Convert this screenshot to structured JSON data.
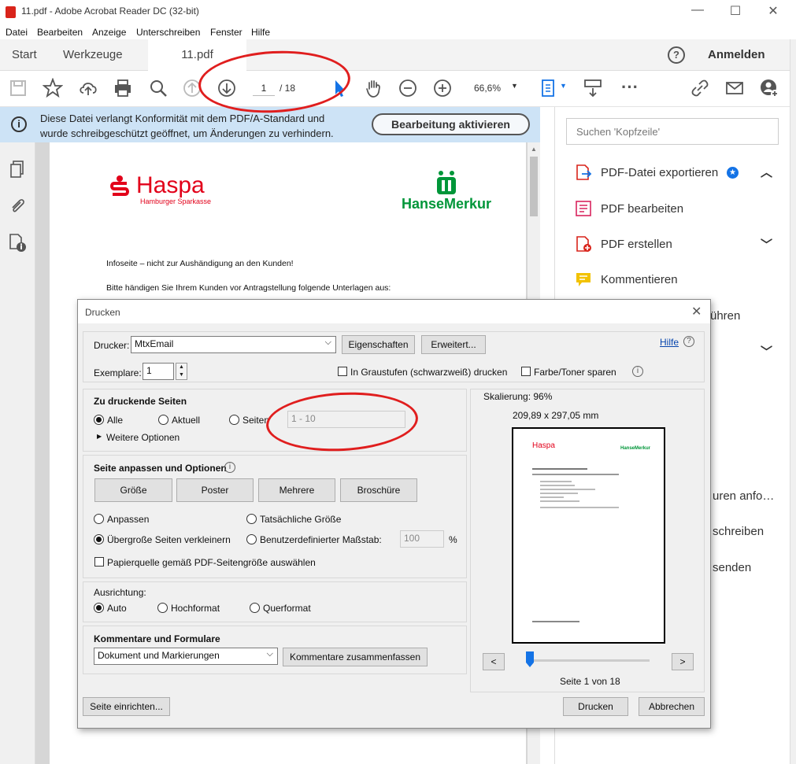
{
  "window": {
    "title": "11.pdf - Adobe Acrobat Reader DC (32-bit)"
  },
  "menu": [
    "Datei",
    "Bearbeiten",
    "Anzeige",
    "Unterschreiben",
    "Fenster",
    "Hilfe"
  ],
  "tabs": {
    "start": "Start",
    "tools": "Werkzeuge",
    "doc": "11.pdf",
    "signin": "Anmelden"
  },
  "toolbar": {
    "page_current": "1",
    "page_total": "/ 18",
    "zoom": "66,6%"
  },
  "notice": {
    "line1": "Diese Datei verlangt Konformität mit dem PDF/A-Standard und",
    "line2": "wurde schreibgeschützt geöffnet, um Änderungen zu verhindern.",
    "button": "Bearbeitung aktivieren"
  },
  "document": {
    "logo_left": "Haspa",
    "logo_left_sub": "Hamburger Sparkasse",
    "logo_right": "HanseMerkur",
    "heading": "Infoseite – nicht zur Aushändigung an den Kunden!",
    "line2": "Bitte händigen Sie Ihrem Kunden vor Antragstellung folgende Unterlagen aus:"
  },
  "right_panel": {
    "search_placeholder": "Suchen 'Kopfzeile'",
    "items": [
      "PDF-Datei exportieren",
      "PDF bearbeiten",
      "PDF erstellen",
      "Kommentieren"
    ],
    "partial": [
      "ühren",
      "uren anfo…",
      "schreiben",
      "senden"
    ]
  },
  "dialog": {
    "title": "Drucken",
    "printer_label": "Drucker:",
    "printer_value": "MtxEmail",
    "properties_btn": "Eigenschaften",
    "advanced_btn": "Erweitert...",
    "help_link": "Hilfe",
    "copies_label": "Exemplare:",
    "copies_value": "1",
    "grayscale": "In Graustufen (schwarzweiß) drucken",
    "save_toner": "Farbe/Toner sparen",
    "pages_heading": "Zu druckende Seiten",
    "opt_all": "Alle",
    "opt_current": "Aktuell",
    "opt_pages": "Seiten",
    "pages_range": "1 - 10",
    "more_options": "Weitere Optionen",
    "sizing_heading": "Seite anpassen und Optionen",
    "btn_size": "Größe",
    "btn_poster": "Poster",
    "btn_multiple": "Mehrere",
    "btn_booklet": "Broschüre",
    "fit": "Anpassen",
    "actual_size": "Tatsächliche Größe",
    "shrink": "Übergroße Seiten verkleinern",
    "custom_scale": "Benutzerdefinierter Maßstab:",
    "scale_value": "100",
    "percent": "%",
    "paper_source": "Papierquelle gemäß PDF-Seitengröße auswählen",
    "orientation_label": "Ausrichtung:",
    "orient_auto": "Auto",
    "orient_portrait": "Hochformat",
    "orient_landscape": "Querformat",
    "comments_heading": "Kommentare und Formulare",
    "comments_value": "Dokument und Markierungen",
    "summarize_btn": "Kommentare zusammenfassen",
    "scaling": "Skalierung:  96%",
    "dimensions": "209,89 x 297,05 mm",
    "prev": "<",
    "next": ">",
    "page_info": "Seite 1 von 18",
    "page_setup_btn": "Seite einrichten...",
    "print_btn": "Drucken",
    "cancel_btn": "Abbrechen",
    "preview_logo_left": "Haspa",
    "preview_logo_right": "HanseMerkur"
  },
  "colors": {
    "accent_blue": "#1473e6",
    "haspa_red": "#e2001a",
    "hanse_green": "#009639",
    "annotation_red": "#e01e1e",
    "notice_bg": "#cde3f6"
  }
}
